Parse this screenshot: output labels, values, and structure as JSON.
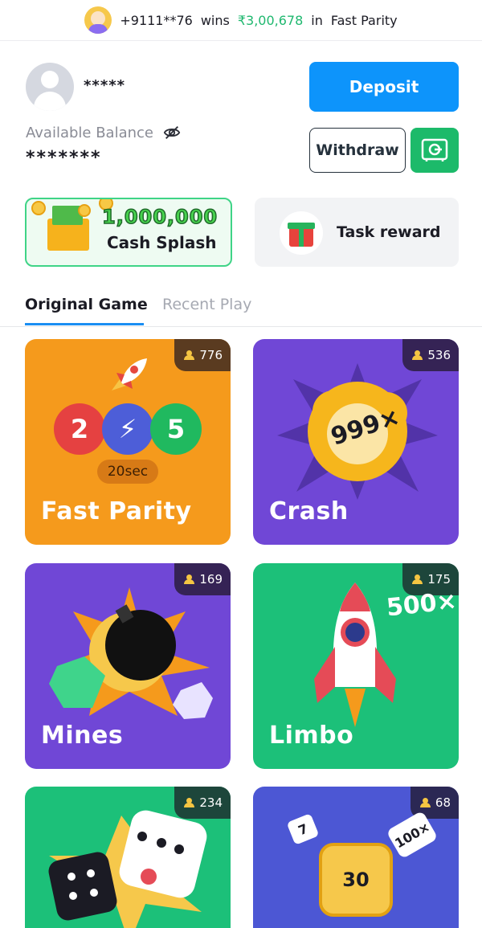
{
  "ticker": {
    "user": "+9111**76",
    "wins": "wins",
    "amount": "₹3,00,678",
    "in": "in",
    "game": "Fast Parity"
  },
  "account": {
    "name": "*****",
    "balance_label": "Available Balance",
    "balance_value": "*******"
  },
  "buttons": {
    "deposit": "Deposit",
    "withdraw": "Withdraw"
  },
  "promos": {
    "cash_amount": "1,000,000",
    "cash_label": "Cash Splash",
    "task_label": "Task reward"
  },
  "tabs": [
    {
      "label": "Original Game",
      "active": true
    },
    {
      "label": "Recent Play",
      "active": false
    }
  ],
  "games": [
    {
      "title": "Fast Parity",
      "players": "776",
      "balls": [
        "2",
        "5"
      ],
      "timer": "20sec",
      "color": "#f59a1c"
    },
    {
      "title": "Crash",
      "players": "536",
      "burst_text": "999×",
      "color": "#7047d6"
    },
    {
      "title": "Mines",
      "players": "169",
      "color": "#7047d6"
    },
    {
      "title": "Limbo",
      "players": "175",
      "multiplier": "500×",
      "color": "#1cc079"
    },
    {
      "title": "",
      "players": "234",
      "color": "#1cc079"
    },
    {
      "title": "",
      "players": "68",
      "tiles": [
        "7",
        "100×",
        "30"
      ],
      "color": "#4c57d4"
    }
  ],
  "colors": {
    "accent": "#0d94fb",
    "green": "#1cba6a",
    "amount": "#1fb86f"
  }
}
